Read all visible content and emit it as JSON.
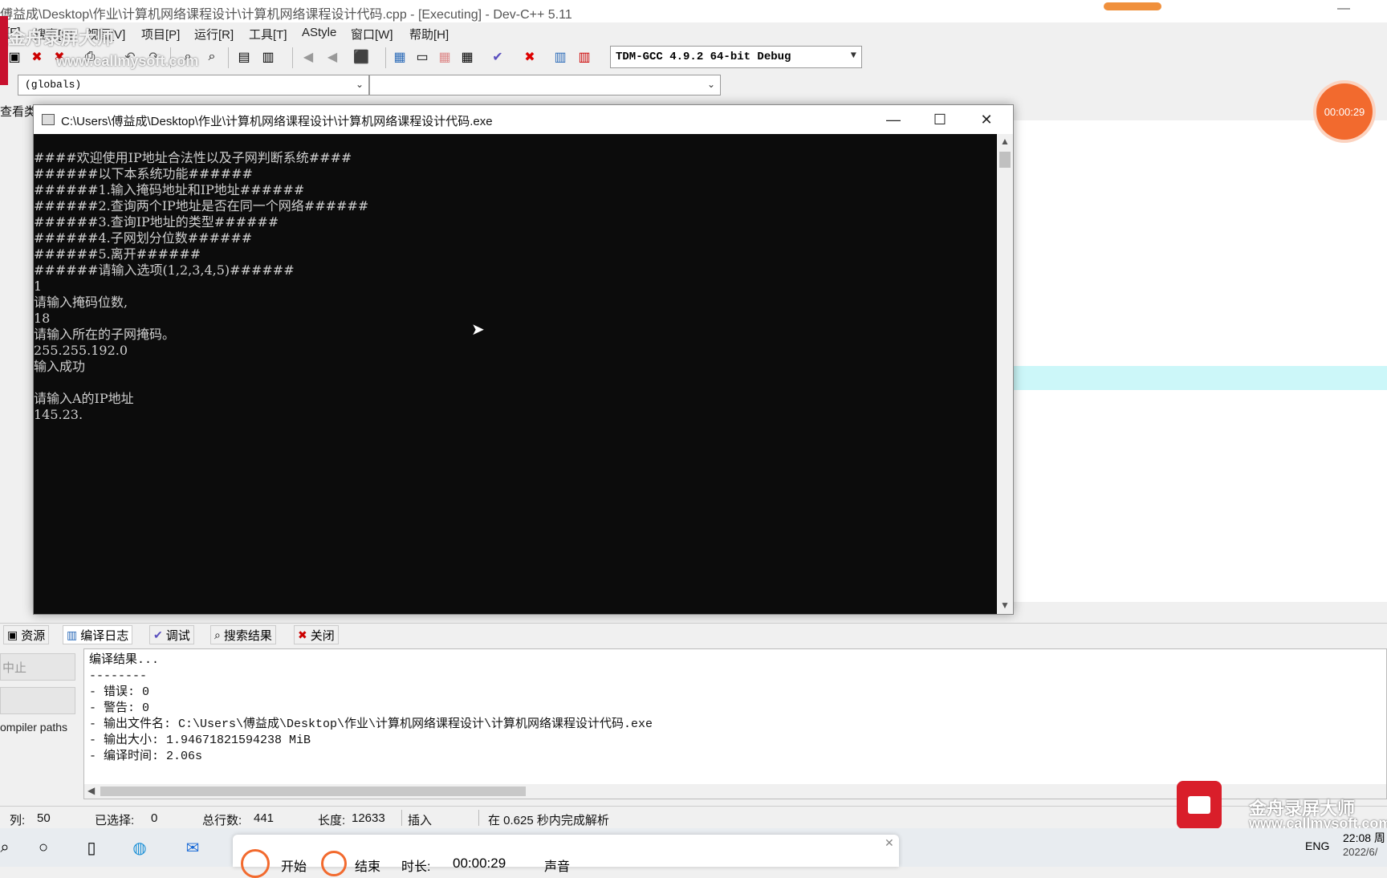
{
  "ide": {
    "title": "傅益成\\Desktop\\作业\\计算机网络课程设计\\计算机网络课程设计代码.cpp - [Executing] - Dev-C++ 5.11",
    "minimize": "—"
  },
  "menu": [
    "[F]",
    "搜索[S]",
    "视图[V]",
    "项目[P]",
    "运行[R]",
    "工具[T]",
    "AStyle",
    "窗口[W]",
    "帮助[H]"
  ],
  "toolbar": {
    "compiler": "TDM-GCC 4.9.2 64-bit Debug"
  },
  "scope": {
    "globals": "(globals)"
  },
  "left_tab": "查看类",
  "watermark": {
    "brand": "金舟录屏大师",
    "url": "www.callmysoft.com"
  },
  "timer": "00:00:29",
  "console": {
    "title": "C:\\Users\\傅益成\\Desktop\\作业\\计算机网络课程设计\\计算机网络课程设计代码.exe",
    "lines": [
      "####欢迎使用IP地址合法性以及子网判断系统####",
      "######以下本系统功能######",
      "######1.输入掩码地址和IP地址######",
      "######2.查询两个IP地址是否在同一个网络######",
      "######3.查询IP地址的类型######",
      "######4.子网划分位数######",
      "######5.离开######",
      "######请输入选项(1,2,3,4,5)######",
      "1",
      "请输入掩码位数,",
      "18",
      "请输入所在的子网掩码。",
      "255.255.192.0",
      "输入成功",
      "",
      "请输入A的IP地址",
      "145.23."
    ]
  },
  "bottom_tabs": [
    "资源",
    "编译日志",
    "调试",
    "搜索结果",
    "关闭"
  ],
  "left_mini": {
    "stop": "中止",
    "compiler_paths": "ompiler paths"
  },
  "output": {
    "lines": [
      "编译结果...",
      "--------",
      "- 错误: 0",
      "- 警告: 0",
      "- 输出文件名: C:\\Users\\傅益成\\Desktop\\作业\\计算机网络课程设计\\计算机网络课程设计代码.exe",
      "- 输出大小: 1.94671821594238 MiB",
      "- 编译时间: 2.06s"
    ]
  },
  "status": {
    "col_label": "列:",
    "col": "50",
    "selected_label": "已选择:",
    "selected": "0",
    "total_label": "总行数:",
    "total": "441",
    "length_label": "长度:",
    "length": "12633",
    "mode": "插入",
    "parse": "在 0.625 秒内完成解析"
  },
  "recorder": {
    "start": "开始",
    "end": "结束",
    "duration_label": "时长:",
    "duration": "00:00:29",
    "sound": "声音"
  },
  "tray": {
    "lang": "ENG",
    "time": "22:08 周",
    "date": "2022/6/"
  }
}
